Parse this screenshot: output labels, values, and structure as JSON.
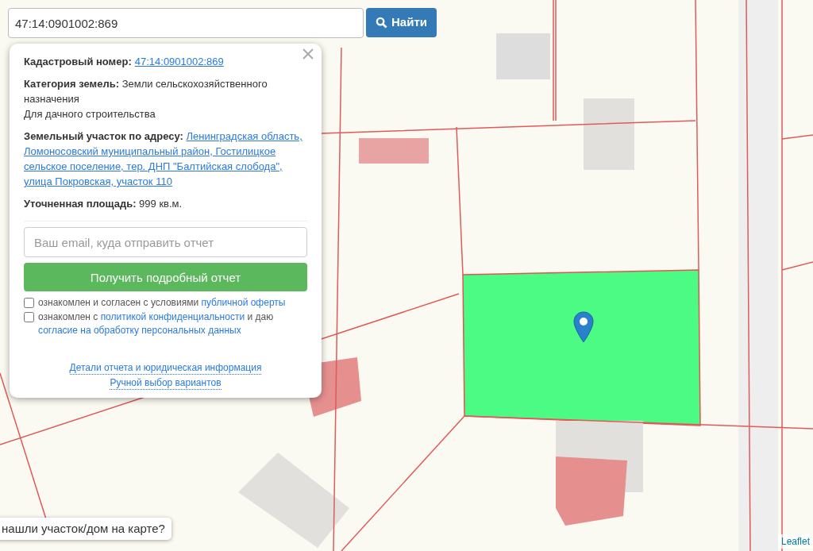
{
  "search": {
    "value": "47:14:0901002:869",
    "button": "Найти"
  },
  "popup": {
    "fields": [
      {
        "label": "Кадастровый номер:",
        "value": "47:14:0901002:869",
        "kind": "link"
      },
      {
        "label": "Категория земель:",
        "value": "Земли сельскохозяйственного назначения",
        "note": "Для дачного строительства",
        "kind": "text"
      },
      {
        "label": "Земельный участок по адресу:",
        "value": "Ленинградская область, Ломоносовский муниципальный район, Гостилицкое сельское поселение, тер. ДНП \"Балтийская слобода\", улица Покровская, участок 110",
        "kind": "address"
      },
      {
        "label": "Уточненная площадь:",
        "value": "999 кв.м.",
        "kind": "text"
      }
    ],
    "email": {
      "placeholder": "Ваш email, куда отправить отчет"
    },
    "submit": "Получить подробный отчет",
    "consents": [
      {
        "checked": false,
        "parts": [
          {
            "text": "ознакомлен и согласен с условиями ",
            "link": false
          },
          {
            "text": "публичной оферты",
            "link": true
          }
        ]
      },
      {
        "checked": false,
        "parts": [
          {
            "text": "ознакомлен с ",
            "link": false
          },
          {
            "text": "политикой конфиденциальности",
            "link": true
          },
          {
            "text": " и даю ",
            "link": false
          },
          {
            "text": "согласие на обработку персональных данных",
            "link": true
          }
        ]
      }
    ],
    "links": [
      "Детали отчета и юридическая информация",
      "Ручной выбор вариантов"
    ]
  },
  "help_button": "нашли участок/дом на карте?",
  "attribution": "Leaflet"
}
